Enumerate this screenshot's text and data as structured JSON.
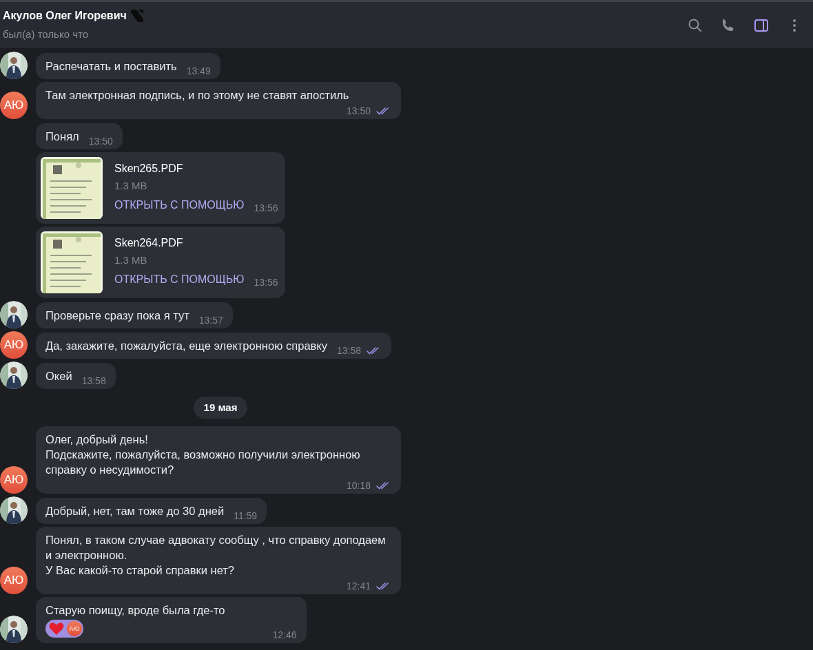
{
  "header": {
    "name": "Акулов Олег Игоревич",
    "status": "был(а) только что",
    "actions": [
      {
        "kind": "search",
        "active": false
      },
      {
        "kind": "call",
        "active": false
      },
      {
        "kind": "sidebar",
        "active": true
      },
      {
        "kind": "more",
        "active": false
      }
    ]
  },
  "messages": [
    {
      "kind": "text",
      "text": "Распечатать и поставить",
      "time": "13:49",
      "read": false
    },
    {
      "kind": "text",
      "avatar": {
        "kind": "initials",
        "initials": "АЮ"
      },
      "text": "Там электронная подпись, и по этому не ставят апостиль",
      "time": "13:50",
      "read": true
    },
    {
      "kind": "text",
      "text": "Понял",
      "time": "13:50",
      "read": false
    },
    {
      "kind": "file",
      "file_name": "Sken265.PDF",
      "size": "1.3 MB",
      "action": "ОТКРЫТЬ С ПОМОЩЬЮ",
      "time": "13:56",
      "read": false
    },
    {
      "kind": "file",
      "file_name": "Sken264.PDF",
      "size": "1.3 MB",
      "action": "ОТКРЫТЬ С ПОМОЩЬЮ",
      "time": "13:56",
      "read": false
    },
    {
      "kind": "text",
      "text": "Проверьте сразу пока я тут",
      "time": "13:57",
      "read": false
    },
    {
      "kind": "text",
      "avatar": {
        "kind": "initials",
        "initials": "АЮ"
      },
      "text": "Да, закажите, пожалуйста, еще электронною справку",
      "time": "13:58",
      "read": true
    },
    {
      "kind": "text",
      "text": "Окей",
      "time": "13:58",
      "read": false
    },
    {
      "kind": "date",
      "text": "19 мая"
    },
    {
      "kind": "text",
      "avatar": {
        "kind": "initials",
        "initials": "АЮ"
      },
      "text": "Олег, добрый день!\nПодскажите, пожалуйста, возможно получили электронною справку о несудимости?",
      "time": "10:18",
      "read": true
    },
    {
      "kind": "text",
      "text": "Добрый, нет, там тоже до 30 дней",
      "time": "11:59",
      "read": false
    },
    {
      "kind": "text",
      "avatar": {
        "kind": "initials",
        "initials": "АЮ"
      },
      "text": "Понял, в таком случае адвокату сообщу , что справку доподаем и электронною.\nУ Вас какой-то старой справки нет?",
      "time": "12:41",
      "read": true
    },
    {
      "kind": "text",
      "text": "Старую поищу, вроде была где-то",
      "time": "12:46",
      "read": false,
      "reaction": {
        "initials": "АЮ"
      }
    }
  ]
}
